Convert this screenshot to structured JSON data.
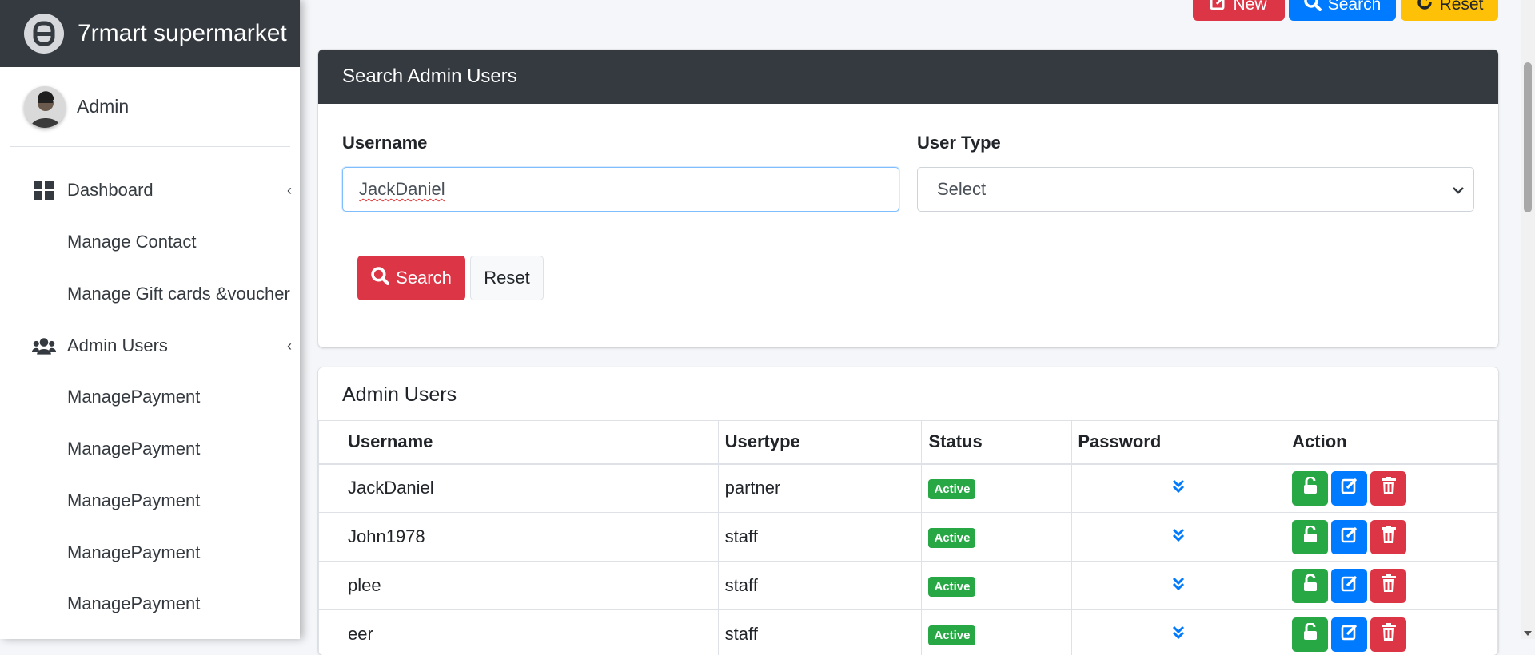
{
  "brand": {
    "name": "7rmart supermarket",
    "icon": "brand-logo-icon"
  },
  "user": {
    "name": "Admin",
    "icon": "avatar"
  },
  "sidebar": {
    "items": [
      {
        "label": "Dashboard",
        "icon": "dashboard-icon",
        "has_caret": true
      },
      {
        "label": "Manage Contact"
      },
      {
        "label": "Manage Gift cards &voucher"
      },
      {
        "label": "Admin Users",
        "icon": "users-icon",
        "has_caret": true
      },
      {
        "label": "ManagePayment"
      },
      {
        "label": "ManagePayment"
      },
      {
        "label": "ManagePayment"
      },
      {
        "label": "ManagePayment"
      },
      {
        "label": "ManagePayment"
      }
    ]
  },
  "toolbar": {
    "new_label": "New",
    "search_label": "Search",
    "reset_label": "Reset"
  },
  "search_card": {
    "title": "Search Admin Users",
    "username_label": "Username",
    "username_value": "JackDaniel",
    "usertype_label": "User Type",
    "usertype_value": "Select",
    "search_button": "Search",
    "reset_button": "Reset"
  },
  "users_card": {
    "title": "Admin Users",
    "columns": [
      "Username",
      "Usertype",
      "Status",
      "Password",
      "Action"
    ],
    "rows": [
      {
        "username": "JackDaniel",
        "usertype": "partner",
        "status": "Active"
      },
      {
        "username": "John1978",
        "usertype": "staff",
        "status": "Active"
      },
      {
        "username": "plee",
        "usertype": "staff",
        "status": "Active"
      },
      {
        "username": "eer",
        "usertype": "staff",
        "status": "Active"
      }
    ]
  },
  "colors": {
    "danger": "#dc3545",
    "primary": "#007bff",
    "warning": "#ffc107",
    "success": "#28a745",
    "dark": "#343a40"
  }
}
